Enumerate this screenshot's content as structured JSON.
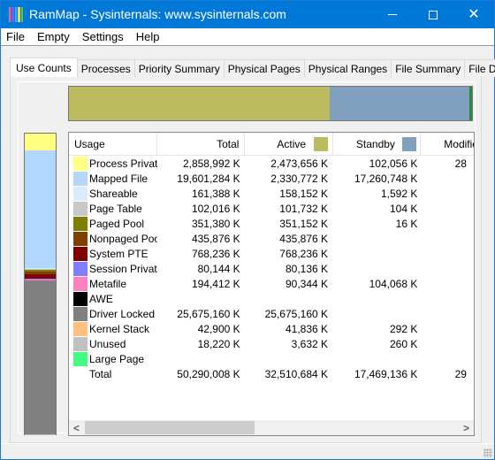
{
  "window": {
    "title": "RamMap - Sysinternals: www.sysinternals.com",
    "icon_colors": [
      "#ff6b6b",
      "#7a5cff",
      "#2ab3ff",
      "#ffd23f",
      "#3cd06a"
    ],
    "controls": {
      "minimize": "minimize",
      "maximize": "maximize",
      "close": "✕"
    }
  },
  "menu": [
    "File",
    "Empty",
    "Settings",
    "Help"
  ],
  "tabs": [
    {
      "label": "Use Counts",
      "active": true
    },
    {
      "label": "Processes",
      "active": false
    },
    {
      "label": "Priority Summary",
      "active": false
    },
    {
      "label": "Physical Pages",
      "active": false
    },
    {
      "label": "Physical Ranges",
      "active": false
    },
    {
      "label": "File Summary",
      "active": false
    },
    {
      "label": "File Details",
      "active": false
    }
  ],
  "summary_bar": {
    "segments": [
      {
        "name": "Active",
        "fraction": 0.6465,
        "color": "#bdbb60"
      },
      {
        "name": "Standby",
        "fraction": 0.3474,
        "color": "#819fbf"
      },
      {
        "name": "Modified",
        "fraction": 0.0061,
        "color": "#2e8b3c"
      }
    ]
  },
  "usage_bar": {
    "segments": [
      {
        "name": "Process Private",
        "fraction": 0.0569,
        "color": "#ffff80"
      },
      {
        "name": "Mapped File",
        "fraction": 0.3898,
        "color": "#b2d7ff"
      },
      {
        "name": "Shareable",
        "fraction": 0.0032,
        "color": "#d9ecff"
      },
      {
        "name": "Page Table",
        "fraction": 0.002,
        "color": "#c8c8c8"
      },
      {
        "name": "Paged Pool",
        "fraction": 0.007,
        "color": "#808000"
      },
      {
        "name": "Nonpaged Pool",
        "fraction": 0.0087,
        "color": "#804000"
      },
      {
        "name": "System PTE",
        "fraction": 0.0153,
        "color": "#800000"
      },
      {
        "name": "Session Private",
        "fraction": 0.0016,
        "color": "#8080ff"
      },
      {
        "name": "Metafile",
        "fraction": 0.0039,
        "color": "#ff80c0"
      },
      {
        "name": "AWE",
        "fraction": 0.0,
        "color": "#000000"
      },
      {
        "name": "Driver Locked",
        "fraction": 0.5106,
        "color": "#808080"
      },
      {
        "name": "Kernel Stack",
        "fraction": 0.0009,
        "color": "#ffc080"
      },
      {
        "name": "Unused",
        "fraction": 0.0004,
        "color": "#c0c0c0"
      },
      {
        "name": "Large Page",
        "fraction": 0.0,
        "color": "#40ff80"
      }
    ]
  },
  "table": {
    "columns": {
      "usage": "Usage",
      "total": "Total",
      "active": "Active",
      "active_color": "#bdbb60",
      "standby": "Standby",
      "standby_color": "#819fbf",
      "modified": "Modifie"
    },
    "rows": [
      {
        "usage": "Process Private",
        "color": "#ffff80",
        "total": "2,858,992 K",
        "active": "2,473,656 K",
        "standby": "102,056 K",
        "modified": "28"
      },
      {
        "usage": "Mapped File",
        "color": "#b2d7ff",
        "total": "19,601,284 K",
        "active": "2,330,772 K",
        "standby": "17,260,748 K",
        "modified": ""
      },
      {
        "usage": "Shareable",
        "color": "#d9ecff",
        "total": "161,388 K",
        "active": "158,152 K",
        "standby": "1,592 K",
        "modified": ""
      },
      {
        "usage": "Page Table",
        "color": "#c8c8c8",
        "total": "102,016 K",
        "active": "101,732 K",
        "standby": "104 K",
        "modified": ""
      },
      {
        "usage": "Paged Pool",
        "color": "#808000",
        "total": "351,380 K",
        "active": "351,152 K",
        "standby": "16 K",
        "modified": ""
      },
      {
        "usage": "Nonpaged Pool",
        "color": "#804000",
        "total": "435,876 K",
        "active": "435,876 K",
        "standby": "",
        "modified": ""
      },
      {
        "usage": "System PTE",
        "color": "#800000",
        "total": "768,236 K",
        "active": "768,236 K",
        "standby": "",
        "modified": ""
      },
      {
        "usage": "Session Private",
        "color": "#8080ff",
        "total": "80,144 K",
        "active": "80,136 K",
        "standby": "",
        "modified": ""
      },
      {
        "usage": "Metafile",
        "color": "#ff80c0",
        "total": "194,412 K",
        "active": "90,344 K",
        "standby": "104,068 K",
        "modified": ""
      },
      {
        "usage": "AWE",
        "color": "#000000",
        "total": "",
        "active": "",
        "standby": "",
        "modified": ""
      },
      {
        "usage": "Driver Locked",
        "color": "#808080",
        "total": "25,675,160 K",
        "active": "25,675,160 K",
        "standby": "",
        "modified": ""
      },
      {
        "usage": "Kernel Stack",
        "color": "#ffc080",
        "total": "42,900 K",
        "active": "41,836 K",
        "standby": "292 K",
        "modified": ""
      },
      {
        "usage": "Unused",
        "color": "#c0c0c0",
        "total": "18,220 K",
        "active": "3,632 K",
        "standby": "260 K",
        "modified": ""
      },
      {
        "usage": "Large Page",
        "color": "#40ff80",
        "total": "",
        "active": "",
        "standby": "",
        "modified": ""
      },
      {
        "usage": "Total",
        "color": null,
        "total": "50,290,008 K",
        "active": "32,510,684 K",
        "standby": "17,469,136 K",
        "modified": "29"
      }
    ]
  },
  "scrollbar": {
    "left_arrow": "<",
    "right_arrow": ">"
  }
}
